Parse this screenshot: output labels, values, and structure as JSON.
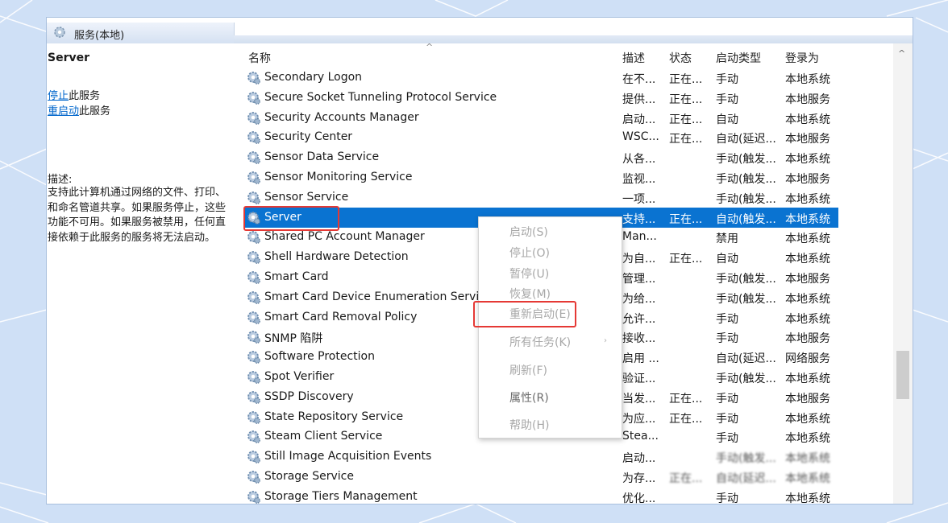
{
  "window": {
    "title": "服务(本地)"
  },
  "left_pane": {
    "title": "Server",
    "stop_link": "停止",
    "stop_suffix": "此服务",
    "restart_link": "重启动",
    "restart_suffix": "此服务",
    "desc_label": "描述:",
    "description": "支持此计算机通过网络的文件、打印、和命名管道共享。如果服务停止，这些功能不可用。如果服务被禁用，任何直接依赖于此服务的服务将无法启动。"
  },
  "columns": {
    "name": "名称",
    "desc": "描述",
    "status": "状态",
    "start": "启动类型",
    "login": "登录为"
  },
  "services": [
    {
      "name": "Secondary Logon",
      "desc": "在不...",
      "status": "正在...",
      "start": "手动",
      "login": "本地系统"
    },
    {
      "name": "Secure Socket Tunneling Protocol Service",
      "desc": "提供...",
      "status": "正在...",
      "start": "手动",
      "login": "本地服务"
    },
    {
      "name": "Security Accounts Manager",
      "desc": "启动...",
      "status": "正在...",
      "start": "自动",
      "login": "本地系统"
    },
    {
      "name": "Security Center",
      "desc": "WSC...",
      "status": "正在...",
      "start": "自动(延迟...",
      "login": "本地服务"
    },
    {
      "name": "Sensor Data Service",
      "desc": "从各...",
      "status": "",
      "start": "手动(触发...",
      "login": "本地系统"
    },
    {
      "name": "Sensor Monitoring Service",
      "desc": "监视...",
      "status": "",
      "start": "手动(触发...",
      "login": "本地服务"
    },
    {
      "name": "Sensor Service",
      "desc": "一项...",
      "status": "",
      "start": "手动(触发...",
      "login": "本地系统"
    },
    {
      "name": "Server",
      "desc": "支持...",
      "status": "正在...",
      "start": "自动(触发...",
      "login": "本地系统"
    },
    {
      "name": "Shared PC Account Manager",
      "desc": "Man...",
      "status": "",
      "start": "禁用",
      "login": "本地系统"
    },
    {
      "name": "Shell Hardware Detection",
      "desc": "为自...",
      "status": "正在...",
      "start": "自动",
      "login": "本地系统"
    },
    {
      "name": "Smart Card",
      "desc": "管理...",
      "status": "",
      "start": "手动(触发...",
      "login": "本地服务"
    },
    {
      "name": "Smart Card Device Enumeration Service",
      "desc": "为给...",
      "status": "",
      "start": "手动(触发...",
      "login": "本地系统"
    },
    {
      "name": "Smart Card Removal Policy",
      "desc": "允许...",
      "status": "",
      "start": "手动",
      "login": "本地系统"
    },
    {
      "name": "SNMP 陷阱",
      "desc": "接收...",
      "status": "",
      "start": "手动",
      "login": "本地服务"
    },
    {
      "name": "Software Protection",
      "desc": "启用 ...",
      "status": "",
      "start": "自动(延迟...",
      "login": "网络服务"
    },
    {
      "name": "Spot Verifier",
      "desc": "验证...",
      "status": "",
      "start": "手动(触发...",
      "login": "本地系统"
    },
    {
      "name": "SSDP Discovery",
      "desc": "当发...",
      "status": "正在...",
      "start": "手动",
      "login": "本地服务"
    },
    {
      "name": "State Repository Service",
      "desc": "为应...",
      "status": "正在...",
      "start": "手动",
      "login": "本地系统"
    },
    {
      "name": "Steam Client Service",
      "desc": "Stea...",
      "status": "",
      "start": "手动",
      "login": "本地系统"
    },
    {
      "name": "Still Image Acquisition Events",
      "desc": "启动...",
      "status": "",
      "start": "手动(触发...",
      "login": "本地系统"
    },
    {
      "name": "Storage Service",
      "desc": "为存...",
      "status": "正在...",
      "start": "自动(延迟...",
      "login": "本地系统"
    },
    {
      "name": "Storage Tiers Management",
      "desc": "优化...",
      "status": "",
      "start": "手动",
      "login": "本地系统"
    }
  ],
  "context_menu": {
    "start": "启动(S)",
    "stop": "停止(O)",
    "pause": "暂停(U)",
    "resume": "恢复(M)",
    "restart": "重新启动(E)",
    "all_tasks": "所有任务(K)",
    "refresh": "刷新(F)",
    "properties": "属性(R)",
    "help": "帮助(H)"
  },
  "colors": {
    "selection": "#0a73d1",
    "highlight_box": "#e53935",
    "link": "#0066cc"
  }
}
